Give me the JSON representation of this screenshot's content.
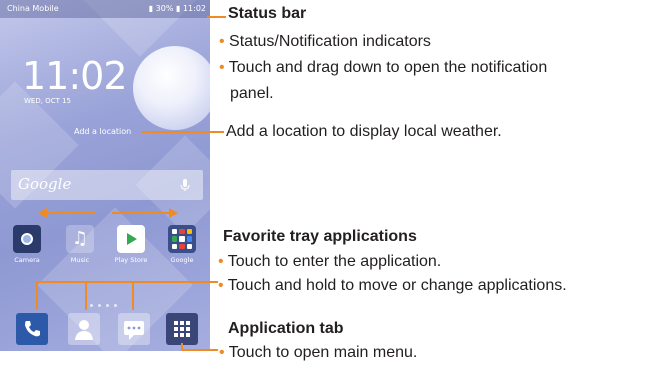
{
  "phone": {
    "carrier": "China Mobile",
    "battery": "30%",
    "time_status": "11:02",
    "clock": "11:02",
    "date": "WED, OCT 15",
    "add_location": "Add a location",
    "search_label": "Google",
    "apps": [
      "Camera",
      "Music",
      "Play Store",
      "Google"
    ]
  },
  "callouts": {
    "status_bar": {
      "title": "Status bar",
      "bullet1": "Status/Notification indicators",
      "bullet2_line1": "Touch and drag down to open the notification",
      "bullet2_line2": "panel."
    },
    "location": "Add a location to display local weather.",
    "favorite": {
      "title": "Favorite tray applications",
      "bullet1": "Touch to enter the application.",
      "bullet2": "Touch and hold to move or change applications."
    },
    "app_tab": {
      "title": "Application tab",
      "bullet1": "Touch to open main menu."
    }
  },
  "colors": {
    "accent": "#f08a24",
    "wallpaper": "#9aa3d8"
  }
}
